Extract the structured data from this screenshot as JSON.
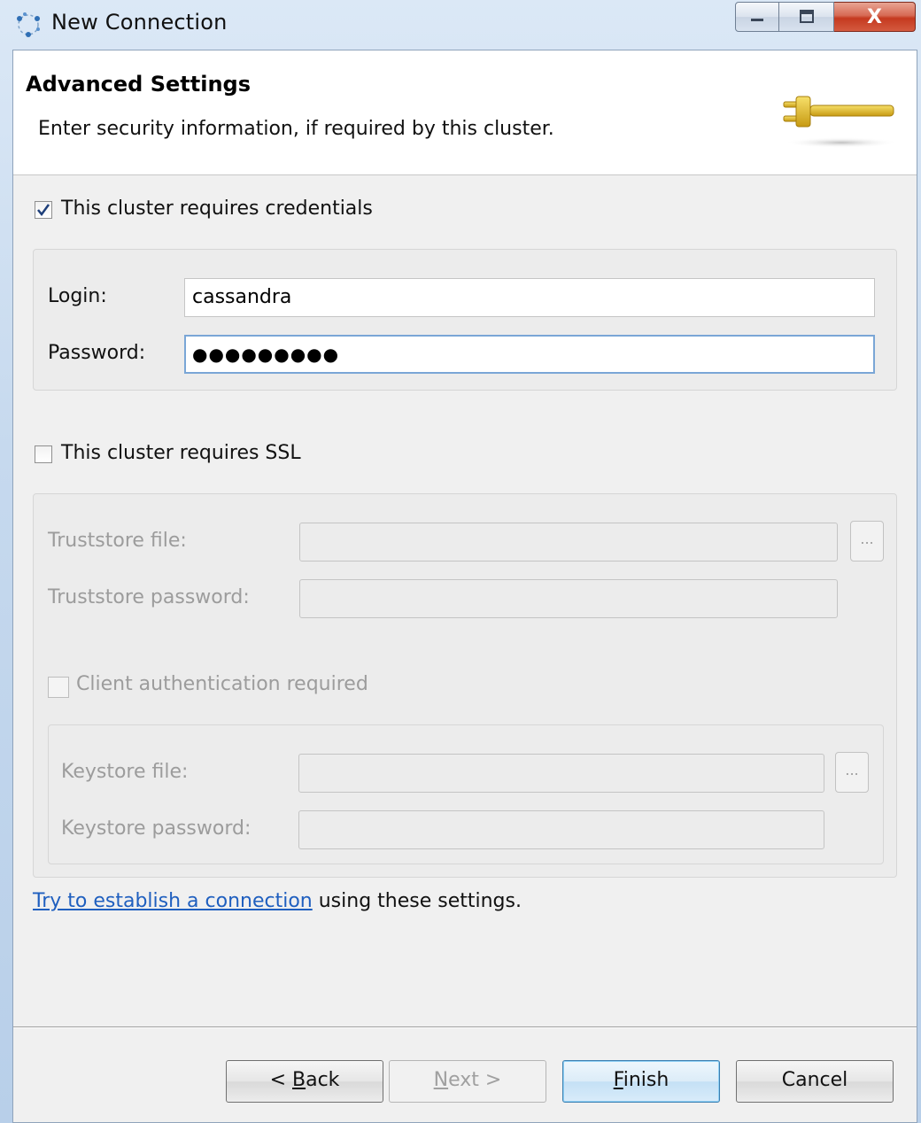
{
  "window": {
    "title": "New Connection",
    "min_icon": "minimize-icon",
    "max_icon": "maximize-icon",
    "close_icon": "close-icon",
    "close_label": "X"
  },
  "header": {
    "title": "Advanced Settings",
    "description": "Enter security information, if required by this cluster.",
    "icon": "plug-icon"
  },
  "credentials": {
    "checkbox_label": "This cluster requires credentials",
    "checked": true,
    "login_label": "Login:",
    "login_value": "cassandra",
    "password_label": "Password:",
    "password_masked": "●●●●●●●●●"
  },
  "ssl": {
    "checkbox_label": "This cluster requires SSL",
    "checked": false,
    "truststore_file_label": "Truststore file:",
    "truststore_password_label": "Truststore password:",
    "browse_label": "...",
    "client_auth_label": "Client authentication required",
    "client_auth_checked": false,
    "keystore_file_label": "Keystore file:",
    "keystore_password_label": "Keystore password:"
  },
  "test_link": {
    "link_text": "Try to establish a connection",
    "suffix_text": " using these settings."
  },
  "buttons": {
    "back_prefix": "< ",
    "back_mnemonic": "B",
    "back_rest": "ack",
    "next_mnemonic": "N",
    "next_rest": "ext >",
    "finish_mnemonic": "F",
    "finish_rest": "inish",
    "cancel": "Cancel"
  },
  "colors": {
    "link": "#1f5fbf",
    "close_button": "#c5391f",
    "default_button_border": "#3c7fb1"
  }
}
